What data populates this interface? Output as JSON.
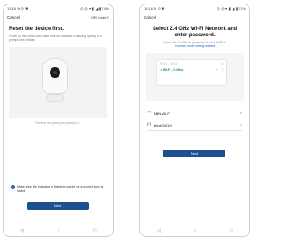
{
  "left_phone": {
    "status": {
      "time": "13:16",
      "indicators": "≋ ⊙ ✱",
      "right": "◎ ◎ ▾ ▮ ◢ ▮74%"
    },
    "appbar": {
      "cancel": "Cancel",
      "qr": "QR Code ≡"
    },
    "title": "Reset the device first.",
    "description": "Power on the device and make sure the indicator is flashing quickly or a prompt tone is heard",
    "hint_link": "Perform net pairing as prompted >",
    "checkbox_label": "Make sure the indicator is flashing quickly or a prompt tone is heard",
    "next_button": "Next",
    "nav": {
      "back": "◁",
      "home": "○",
      "recent": "□"
    }
  },
  "right_phone": {
    "status": {
      "time": "13:16",
      "indicators": "≋ ⊙ ✱",
      "right": "◎ ◎ ▾ ▮ ◢ ▮74%"
    },
    "appbar": {
      "cancel": "Cancel"
    },
    "title": "Select 2.4 GHz Wi-Fi Network and enter password.",
    "description": "If your Wi-Fi is 5GHz, please set it to be 2.4GHz.",
    "description_link": "Common router setting method",
    "wifi_list": [
      {
        "name": "Wi-Fi - 5Ghz",
        "selected": false,
        "icons": "✕"
      },
      {
        "name": "✓ Wi-Fi - 2.4Ghz",
        "selected": true,
        "icons": "≋ ◦ ⓘ"
      },
      {
        "name": "",
        "selected": false,
        "icons": ""
      },
      {
        "name": "",
        "selected": false,
        "icons": ""
      }
    ],
    "ssid": {
      "value": "ABN Wi-Fi",
      "action": "⇄"
    },
    "password": {
      "value": "abn@2019!",
      "action": "◉"
    },
    "next_button": "Next",
    "nav": {
      "back": "◁",
      "home": "○",
      "recent": "□"
    }
  }
}
